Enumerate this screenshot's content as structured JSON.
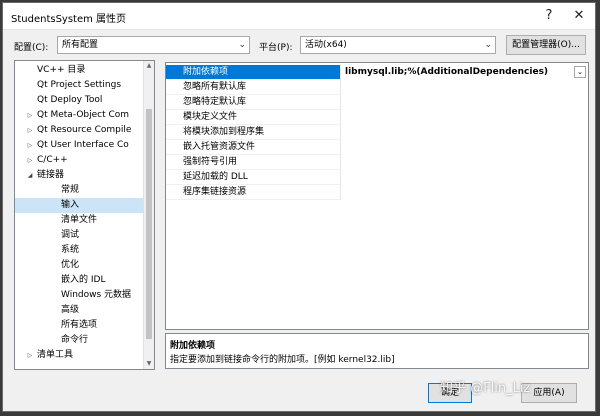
{
  "window": {
    "title": "StudentsSystem 属性页",
    "help_glyph": "?",
    "close_glyph": "✕"
  },
  "config": {
    "label": "配置(C):",
    "value": "所有配置",
    "platform_label": "平台(P):",
    "platform_value": "活动(x64)",
    "manager_button": "配置管理器(O)..."
  },
  "tree": {
    "items": [
      {
        "label": "VC++ 目录",
        "level": 1,
        "twisty": ""
      },
      {
        "label": "Qt Project Settings",
        "level": 1,
        "twisty": ""
      },
      {
        "label": "Qt Deploy Tool",
        "level": 1,
        "twisty": ""
      },
      {
        "label": "Qt Meta-Object Com",
        "level": 1,
        "twisty": "▷"
      },
      {
        "label": "Qt Resource Compile",
        "level": 1,
        "twisty": "▷"
      },
      {
        "label": "Qt User Interface Co",
        "level": 1,
        "twisty": "▷"
      },
      {
        "label": "C/C++",
        "level": 1,
        "twisty": "▷"
      },
      {
        "label": "链接器",
        "level": 1,
        "twisty": "◢"
      },
      {
        "label": "常规",
        "level": 2,
        "twisty": ""
      },
      {
        "label": "输入",
        "level": 2,
        "twisty": "",
        "selected": true
      },
      {
        "label": "清单文件",
        "level": 2,
        "twisty": ""
      },
      {
        "label": "调试",
        "level": 2,
        "twisty": ""
      },
      {
        "label": "系统",
        "level": 2,
        "twisty": ""
      },
      {
        "label": "优化",
        "level": 2,
        "twisty": ""
      },
      {
        "label": "嵌入的 IDL",
        "level": 2,
        "twisty": ""
      },
      {
        "label": "Windows 元数据",
        "level": 2,
        "twisty": ""
      },
      {
        "label": "高级",
        "level": 2,
        "twisty": ""
      },
      {
        "label": "所有选项",
        "level": 2,
        "twisty": ""
      },
      {
        "label": "命令行",
        "level": 2,
        "twisty": ""
      },
      {
        "label": "清单工具",
        "level": 1,
        "twisty": "▷"
      }
    ]
  },
  "properties": {
    "rows": [
      {
        "name": "附加依赖项",
        "value": "libmysql.lib;%(AdditionalDependencies)",
        "selected": true
      },
      {
        "name": "忽略所有默认库",
        "value": ""
      },
      {
        "name": "忽略特定默认库",
        "value": ""
      },
      {
        "name": "模块定义文件",
        "value": ""
      },
      {
        "name": "将模块添加到程序集",
        "value": ""
      },
      {
        "name": "嵌入托管资源文件",
        "value": ""
      },
      {
        "name": "强制符号引用",
        "value": ""
      },
      {
        "name": "延迟加载的 DLL",
        "value": ""
      },
      {
        "name": "程序集链接资源",
        "value": ""
      }
    ]
  },
  "description": {
    "title": "附加依赖项",
    "text": "指定要添加到链接命令行的附加项。[例如 kernel32.lib]"
  },
  "buttons": {
    "ok": "确定",
    "apply": "应用(A)"
  },
  "watermark": "知乎 @Flin_Liz"
}
